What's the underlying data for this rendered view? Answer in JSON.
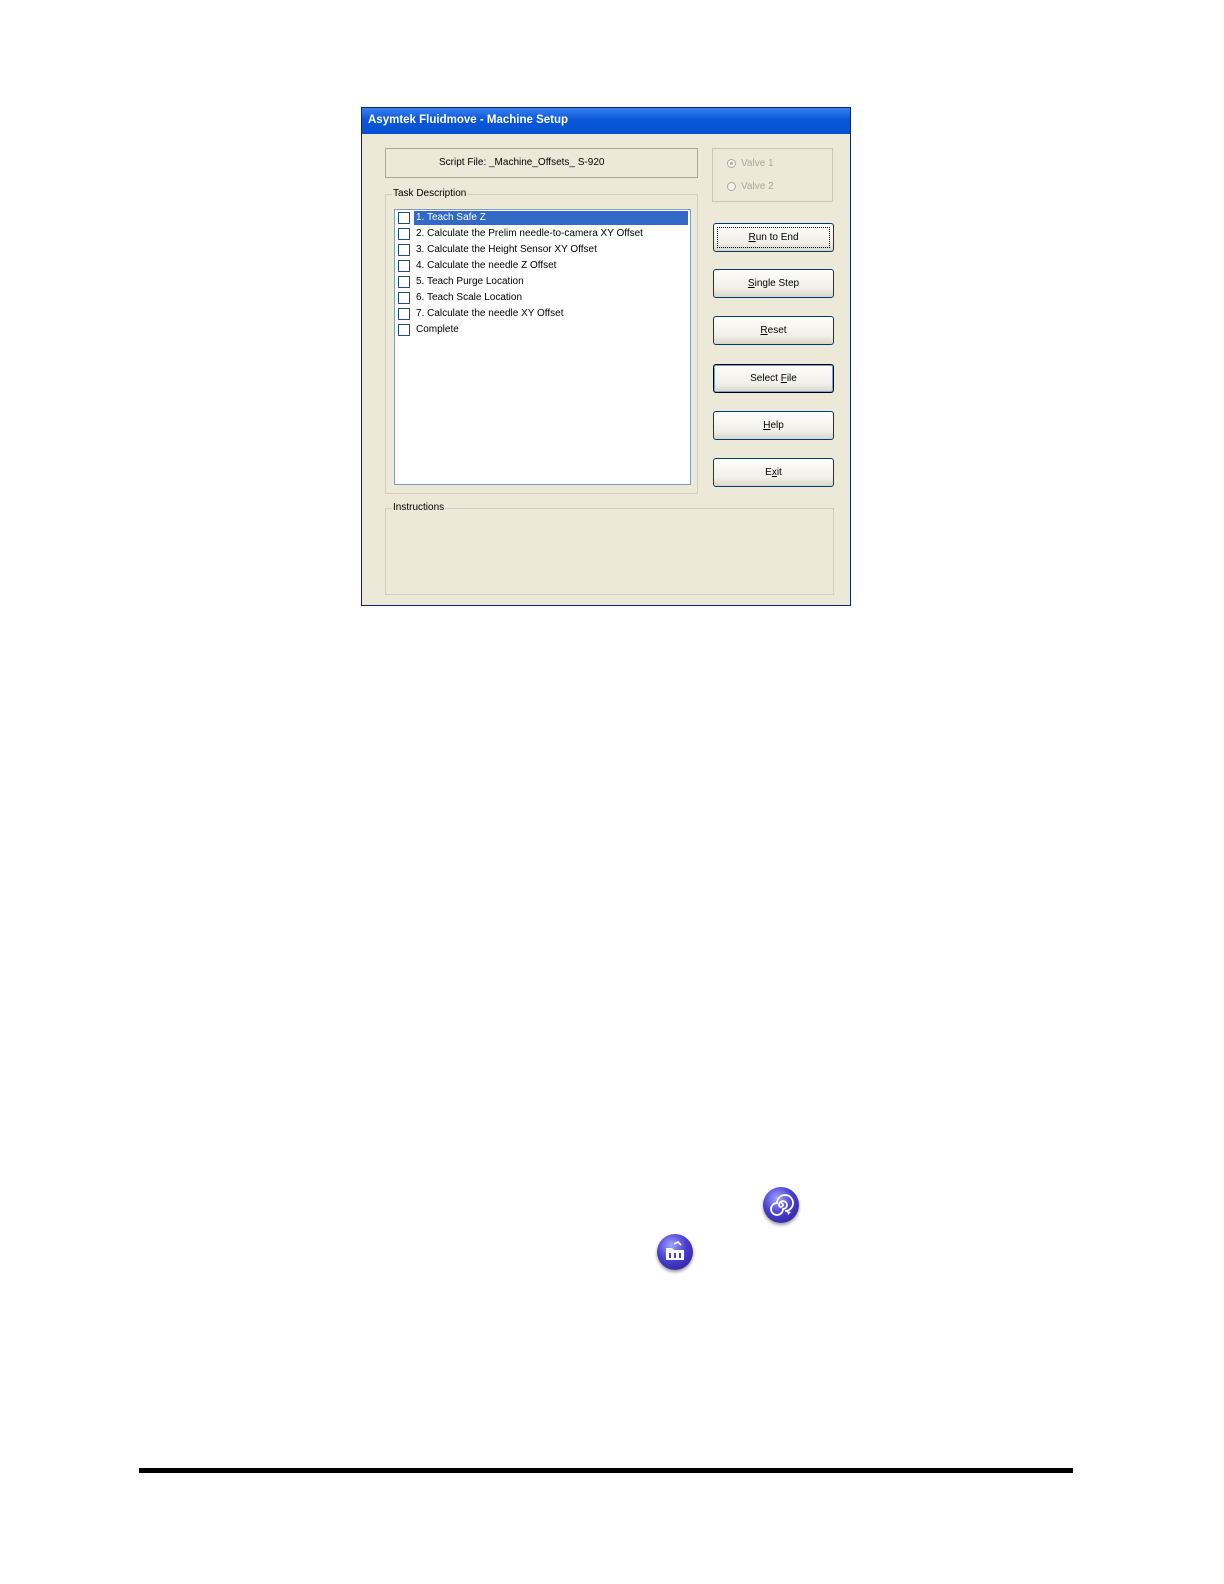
{
  "window": {
    "title": "Asymtek Fluidmove - Machine Setup"
  },
  "script_file": {
    "label": "Script File:",
    "value": "_Machine_Offsets_ S-920"
  },
  "valves": [
    {
      "label": "Valve 1",
      "selected": true
    },
    {
      "label": "Valve 2",
      "selected": false
    }
  ],
  "task_group": {
    "legend": "Task Description",
    "items": [
      {
        "label": "1. Teach Safe Z",
        "checked": false,
        "selected": true
      },
      {
        "label": "2. Calculate the Prelim needle-to-camera XY Offset",
        "checked": false,
        "selected": false
      },
      {
        "label": "3. Calculate the Height Sensor XY Offset",
        "checked": false,
        "selected": false
      },
      {
        "label": "4. Calculate the needle Z Offset",
        "checked": false,
        "selected": false
      },
      {
        "label": "5. Teach Purge Location",
        "checked": false,
        "selected": false
      },
      {
        "label": "6. Teach Scale Location",
        "checked": false,
        "selected": false
      },
      {
        "label": "7. Calculate the needle XY Offset",
        "checked": false,
        "selected": false
      },
      {
        "label": "Complete",
        "checked": false,
        "selected": false
      }
    ]
  },
  "buttons": {
    "run_to_end": {
      "accel": "R",
      "rest": "un to End"
    },
    "single_step": {
      "accel": "S",
      "rest": "ingle Step"
    },
    "reset": {
      "accel": "R",
      "rest": "eset"
    },
    "select_file": {
      "pre": "Select ",
      "accel": "F",
      "rest": "ile"
    },
    "help": {
      "accel": "H",
      "rest": "elp"
    },
    "exit": {
      "pre": "E",
      "accel": "x",
      "rest": "it"
    }
  },
  "instructions": {
    "legend": "Instructions"
  },
  "icons": [
    "spiral-run-icon",
    "folder-open-icon"
  ],
  "colors": {
    "title_bar": "#0a58d8",
    "selection": "#316ac5",
    "dialog_bg": "#ece9d8",
    "icon_purple": "#4a40d0"
  }
}
